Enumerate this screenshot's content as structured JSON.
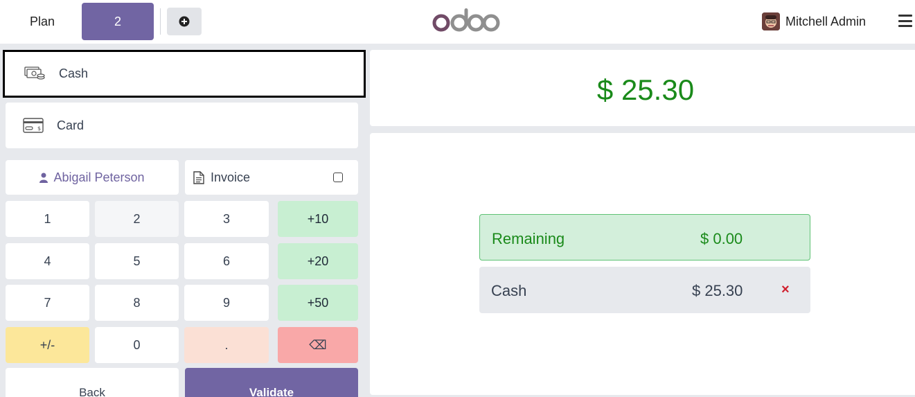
{
  "header": {
    "plan_label": "Plan",
    "order_tab": "2",
    "user_name": "Mitchell Admin",
    "logo": "odoo"
  },
  "payment_methods": [
    {
      "label": "Cash",
      "icon": "cash-icon",
      "selected": true
    },
    {
      "label": "Card",
      "icon": "card-icon",
      "selected": false
    }
  ],
  "customer": {
    "name": "Abigail Peterson",
    "icon": "user-icon"
  },
  "invoice": {
    "label": "Invoice",
    "checked": false,
    "icon": "document-icon"
  },
  "numpad": {
    "row1": [
      "1",
      "2",
      "3",
      "+10"
    ],
    "row2": [
      "4",
      "5",
      "6",
      "+20"
    ],
    "row3": [
      "7",
      "8",
      "9",
      "+50"
    ],
    "row4": [
      "+/-",
      "0",
      ".",
      "⌫"
    ]
  },
  "actions": {
    "back": "Back",
    "validate": "Validate"
  },
  "summary": {
    "total": "$ 25.30",
    "remaining_label": "Remaining",
    "remaining_value": "$ 0.00",
    "line_method": "Cash",
    "line_amount": "$ 25.30",
    "line_delete": "×"
  },
  "colors": {
    "brand": "#7165a3",
    "total_green": "#1a8a1a",
    "remaining_bg": "#d3efdb",
    "delete_red": "#d0202e"
  }
}
